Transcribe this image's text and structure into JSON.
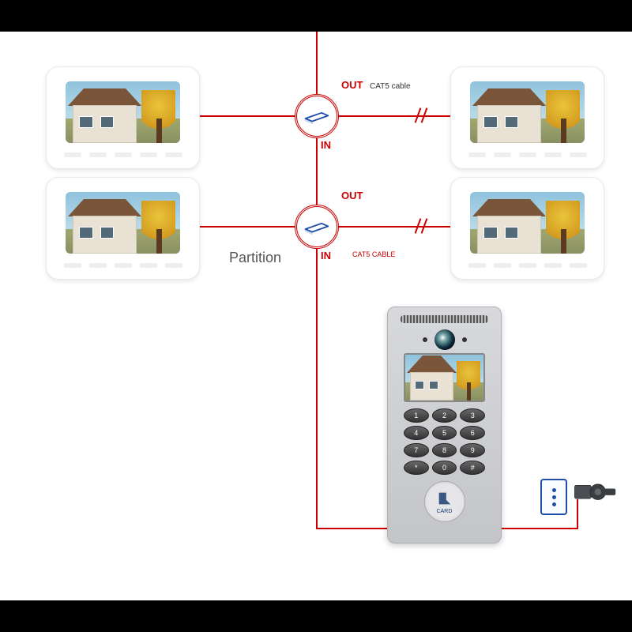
{
  "labels": {
    "out1": "OUT",
    "in1": "IN",
    "out2": "OUT",
    "in2": "IN",
    "cat5_top": "CAT5 cable",
    "cat5_bottom": "CAT5 CABLE",
    "partition": "Partition",
    "card": "CARD"
  },
  "keypad": [
    "1",
    "2",
    "3",
    "4",
    "5",
    "6",
    "7",
    "8",
    "9",
    "*",
    "0",
    "#"
  ],
  "colors": {
    "wire": "#c00",
    "accent_blue": "#1e4ea8"
  },
  "diagram": {
    "monitors": 4,
    "distributors": 2,
    "door_stations": 1,
    "exit_button": 1,
    "lock": 1,
    "cable_type": "CAT5"
  }
}
